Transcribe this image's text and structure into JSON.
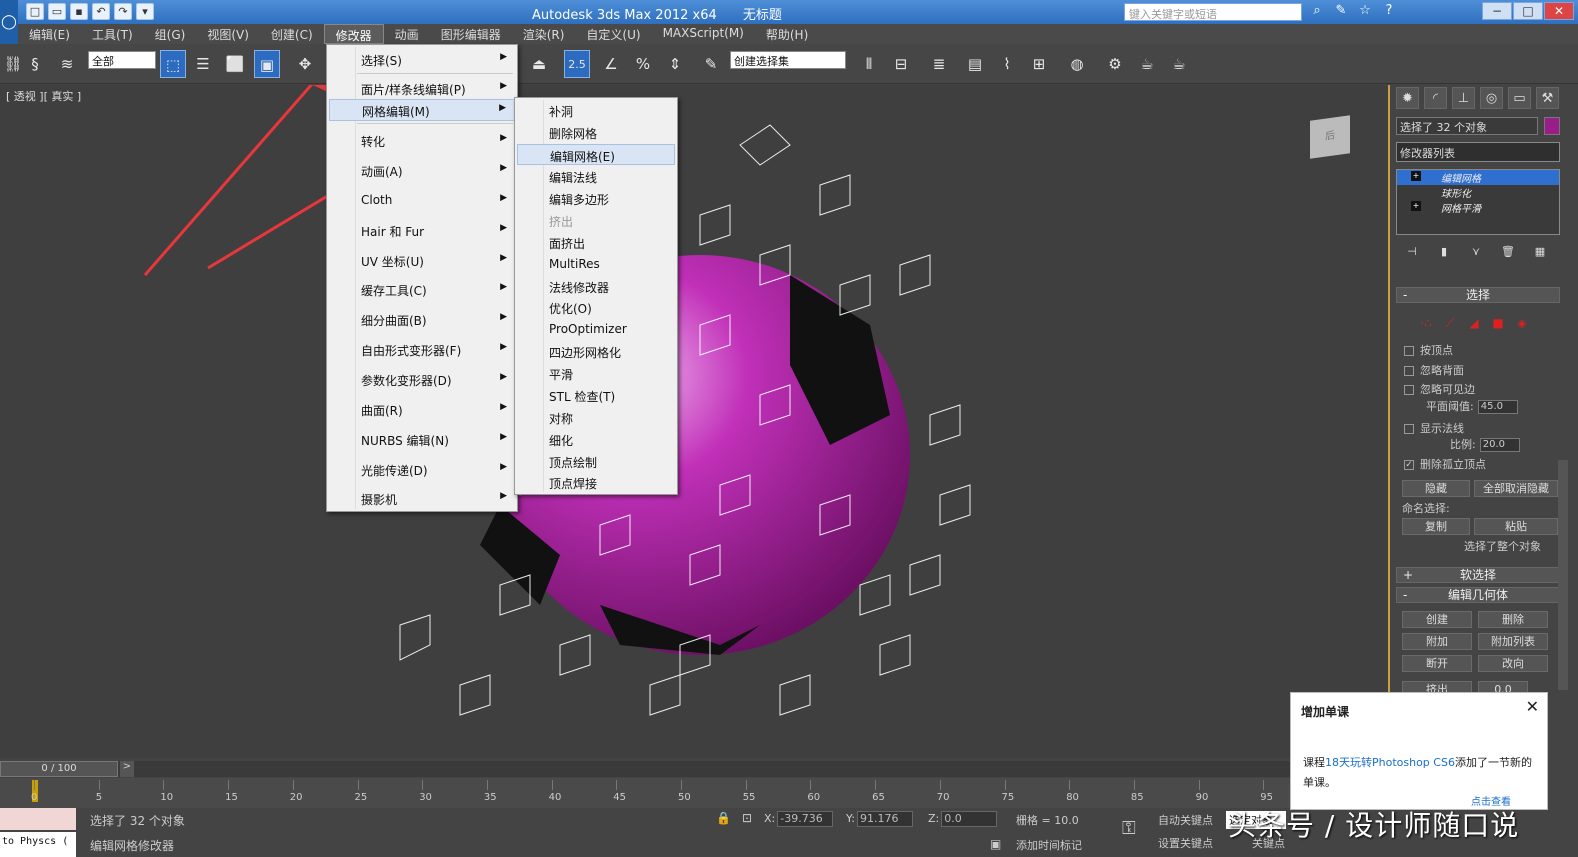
{
  "title": {
    "app": "Autodesk 3ds Max  2012 x64",
    "doc": "无标题"
  },
  "search": {
    "placeholder": "键入关键字或短语"
  },
  "menubar": [
    "编辑(E)",
    "工具(T)",
    "组(G)",
    "视图(V)",
    "创建(C)",
    "修改器",
    "动画",
    "图形编辑器",
    "渲染(R)",
    "自定义(U)",
    "MAXScript(M)",
    "帮助(H)"
  ],
  "toolbar": {
    "filter": "全部",
    "selection_set": "创建选择集",
    "snap_label": "2.5"
  },
  "viewport": {
    "label": "[ 透视 ][ 真实 ]",
    "viewcube": "后"
  },
  "modifiers_menu": [
    "选择(S)",
    "面片/样条线编辑(P)",
    "网格编辑(M)",
    "转化",
    "动画(A)",
    "Cloth",
    "Hair 和 Fur",
    "UV 坐标(U)",
    "缓存工具(C)",
    "细分曲面(B)",
    "自由形式变形器(F)",
    "参数化变形器(D)",
    "曲面(R)",
    "NURBS 编辑(N)",
    "光能传递(D)",
    "摄影机"
  ],
  "mesh_submenu": [
    "补洞",
    "删除网格",
    "编辑网格(E)",
    "编辑法线",
    "编辑多边形",
    "挤出",
    "面挤出",
    "MultiRes",
    "法线修改器",
    "优化(O)",
    "ProOptimizer",
    "四边形网格化",
    "平滑",
    "STL 检查(T)",
    "对称",
    "细化",
    "顶点绘制",
    "顶点焊接"
  ],
  "panel": {
    "object_name": "选择了 32 个对象",
    "modifier_list": "修改器列表",
    "stack": [
      "编辑网格",
      "球形化",
      "网格平滑"
    ],
    "rollout_select": "选择",
    "checks": [
      "按顶点",
      "忽略背面",
      "忽略可见边",
      "显示法线",
      "删除孤立顶点"
    ],
    "plane_thresh_label": "平面阈值:",
    "plane_thresh": "45.0",
    "scale_label": "比例:",
    "scale": "20.0",
    "btn_hide": "隐藏",
    "btn_unhide": "全部取消隐藏",
    "named_sel": "命名选择:",
    "btn_copy": "复制",
    "btn_paste": "粘贴",
    "sel_info": "选择了整个对象",
    "rollout_soft": "软选择",
    "rollout_geom": "编辑几何体",
    "btn_create": "创建",
    "btn_delete": "删除",
    "btn_attach": "附加",
    "btn_attach_list": "附加列表",
    "btn_break": "断开",
    "btn_turn": "改向",
    "btn_extrude": "挤出",
    "extrude_val": "0.0"
  },
  "timeline": {
    "frame": "0 / 100",
    "ticks": [
      "0",
      "5",
      "10",
      "15",
      "20",
      "25",
      "30",
      "35",
      "40",
      "45",
      "50",
      "55",
      "60",
      "65",
      "70",
      "75",
      "80",
      "85",
      "90",
      "95"
    ]
  },
  "status": {
    "maxscript": "to Physcs (",
    "line1": "选择了 32 个对象",
    "line2": "编辑网格修改器",
    "x_label": "X:",
    "x": "-39.736",
    "y_label": "Y:",
    "y": "91.176",
    "z_label": "Z:",
    "z": "0.0",
    "grid": "栅格 = 10.0",
    "add_time_tag": "添加时间标记",
    "auto_key": "自动关键点",
    "set_key": "设置关键点",
    "selected": "选定对象",
    "key_filter": "关键点"
  },
  "notify": {
    "title": "增加单课",
    "prefix": "课程",
    "link": "18天玩转Photoshop CS6",
    "suffix": "添加了一节新的单课。",
    "link2": "点击查看"
  },
  "watermark": "头条号 / 设计师随口说",
  "colors": {
    "object": "#9a1e8a",
    "accent": "#2c6bbf",
    "arrow": "#e8373a"
  }
}
